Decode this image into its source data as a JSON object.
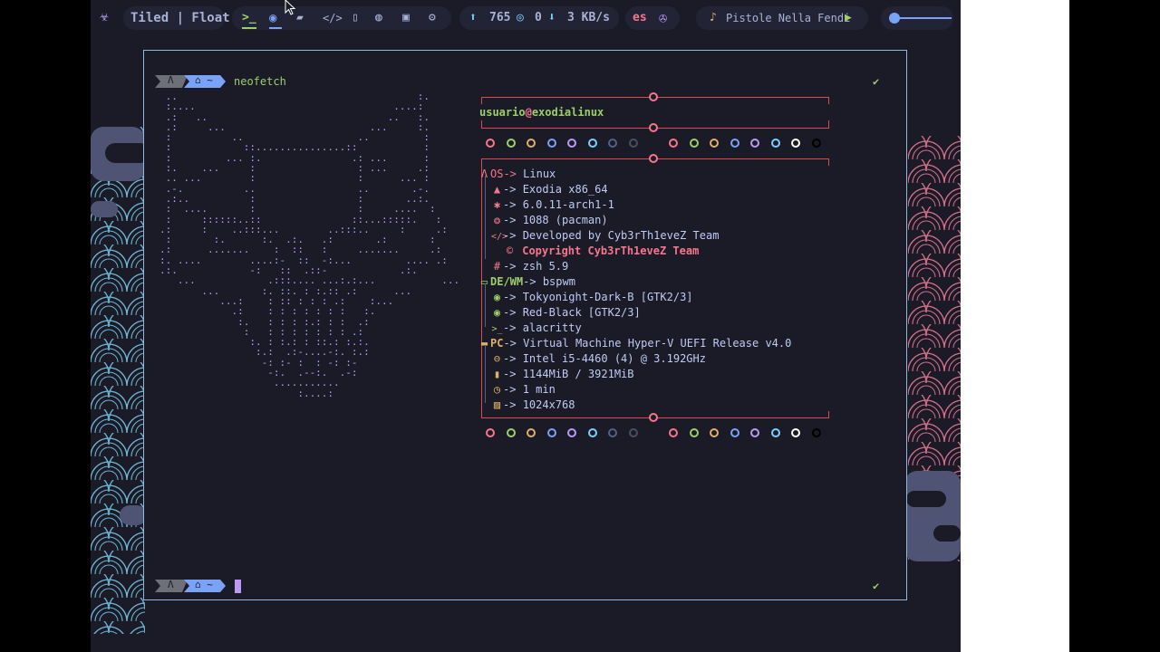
{
  "bar": {
    "layout_label": "Tiled | Float",
    "workspace_icons": [
      "terminal-icon",
      "firefox-icon",
      "folder-icon",
      "code-icon",
      "document-icon",
      "chat-icon",
      "youtube-icon",
      "gear-icon"
    ],
    "updates": "765",
    "github": "0",
    "net_speed": "3 KB/s",
    "keyboard_layout": "es",
    "music_title": "Pistole Nella Fendi",
    "volume_fraction": 0.05
  },
  "terminal": {
    "command": "neofetch",
    "prompt_os_icon": "Λ",
    "prompt_home": "⌂ ~",
    "check_mark": "✔",
    "user_host": {
      "user": "usuario",
      "at": "@",
      "host": "exodialinux"
    },
    "sections": {
      "os": {
        "label": "OS",
        "value": "Linux"
      },
      "distro": "Exodia x86_64",
      "kernel": "6.0.11-arch1-1",
      "packages": "1088 (pacman)",
      "developed": "Developed by Cyb3rTh1eveZ Team",
      "copyright": "Copyright Cyb3rTh1eveZ Team",
      "shell": "zsh 5.9",
      "de": {
        "label": "DE/WM",
        "value": "bspwm"
      },
      "theme": "Tokyonight-Dark-B [GTK2/3]",
      "icons": "Red-Black [GTK2/3]",
      "term": "alacritty",
      "pc": {
        "label": "PC",
        "value": "Virtual Machine Hyper-V UEFI Release v4.0"
      },
      "cpu": "Intel i5-4460 (4) @ 3.192GHz",
      "memory": "1144MiB / 3921MiB",
      "uptime": "1 min",
      "resolution": "1024x768"
    },
    "arrow": "->",
    "palette": [
      "#f7768e",
      "#9ece6a",
      "#e0af68",
      "#7aa2f7",
      "#bb9af7",
      "#7dcfff",
      "#565f89",
      "#4a4d63",
      "#f7768e",
      "#9ece6a",
      "#e0af68",
      "#7aa2f7",
      "#bb9af7",
      "#7dcfff",
      "#ffffff",
      "#000000"
    ]
  },
  "colors": {
    "accent": "#7aa2f7",
    "green": "#9ece6a",
    "red": "#f7768e",
    "purple": "#bb9af7",
    "bg": "#1a1b26"
  }
}
